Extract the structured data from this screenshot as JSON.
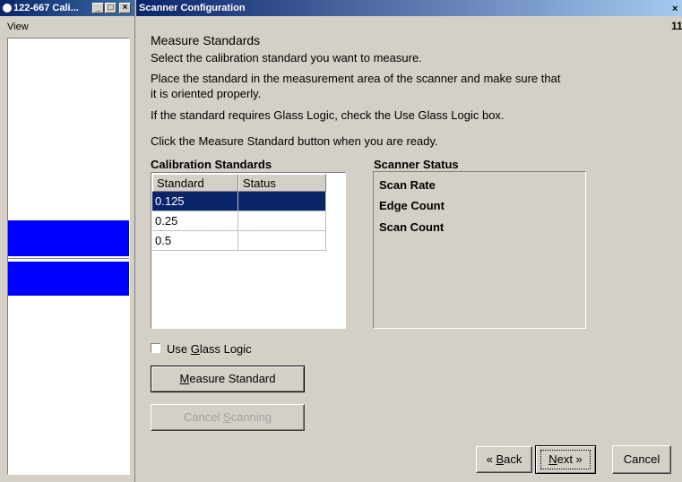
{
  "left_window": {
    "title": "122-667 Cali...",
    "menu": "View",
    "minimize": "_",
    "maximize": "□",
    "close": "×"
  },
  "dialog": {
    "title": "Scanner Configuration",
    "close": "×",
    "edge_number": "11"
  },
  "content": {
    "heading": "Measure Standards",
    "instructions": [
      "Select the calibration standard you want to measure.",
      "Place the standard in the measurement area of the scanner and make sure that",
      "it is oriented properly.",
      "If the standard requires Glass Logic, check the Use Glass Logic box.",
      "Click the Measure Standard button when you are ready."
    ]
  },
  "calibration": {
    "label": "Calibration Standards",
    "columns": [
      "Standard",
      "Status"
    ],
    "rows": [
      {
        "standard": "0.125",
        "status": "",
        "selected": true
      },
      {
        "standard": "0.25",
        "status": "",
        "selected": false
      },
      {
        "standard": "0.5",
        "status": "",
        "selected": false
      }
    ]
  },
  "scanner_status": {
    "label": "Scanner Status",
    "items": [
      "Scan Rate",
      "Edge Count",
      "Scan Count"
    ]
  },
  "glass_logic": {
    "label_pre": "Use ",
    "label_hotkey": "G",
    "label_post": "lass Logic",
    "checked": false
  },
  "buttons": {
    "measure": {
      "hotkey": "M",
      "rest": "easure Standard"
    },
    "cancel_scanning": {
      "pre": "Cancel ",
      "hotkey": "S",
      "rest": "canning"
    },
    "back": {
      "pre": "« ",
      "hotkey": "B",
      "rest": "ack"
    },
    "next": {
      "hotkey": "N",
      "rest": "ext »"
    },
    "cancel": "Cancel"
  },
  "colors": {
    "selection": "#0a246a",
    "band": "#0000ff",
    "dialog_bg": "#d4d0c8"
  }
}
